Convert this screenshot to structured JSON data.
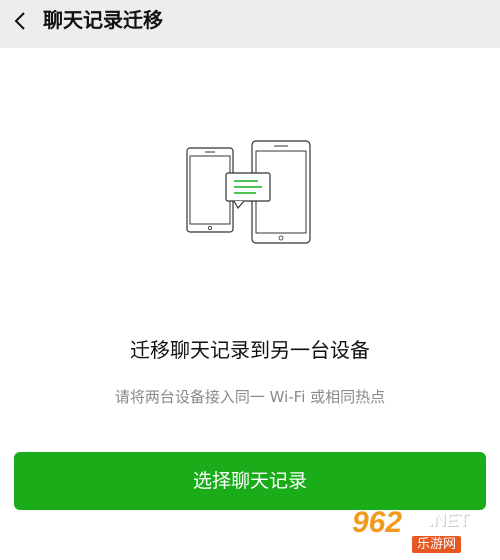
{
  "header": {
    "back_icon": "chevron-left-icon",
    "title": "聊天记录迁移"
  },
  "illustration": {
    "icon": "devices-transfer-icon",
    "accent_color": "#1aad19"
  },
  "content": {
    "title": "迁移聊天记录到另一台设备",
    "subtitle": "请将两台设备接入同一 Wi-Fi 或相同热点"
  },
  "action": {
    "button_label": "选择聊天记录",
    "button_color": "#1aad19"
  },
  "watermark": {
    "logo": "962",
    "suffix": ".NET",
    "tag": "乐游网"
  }
}
